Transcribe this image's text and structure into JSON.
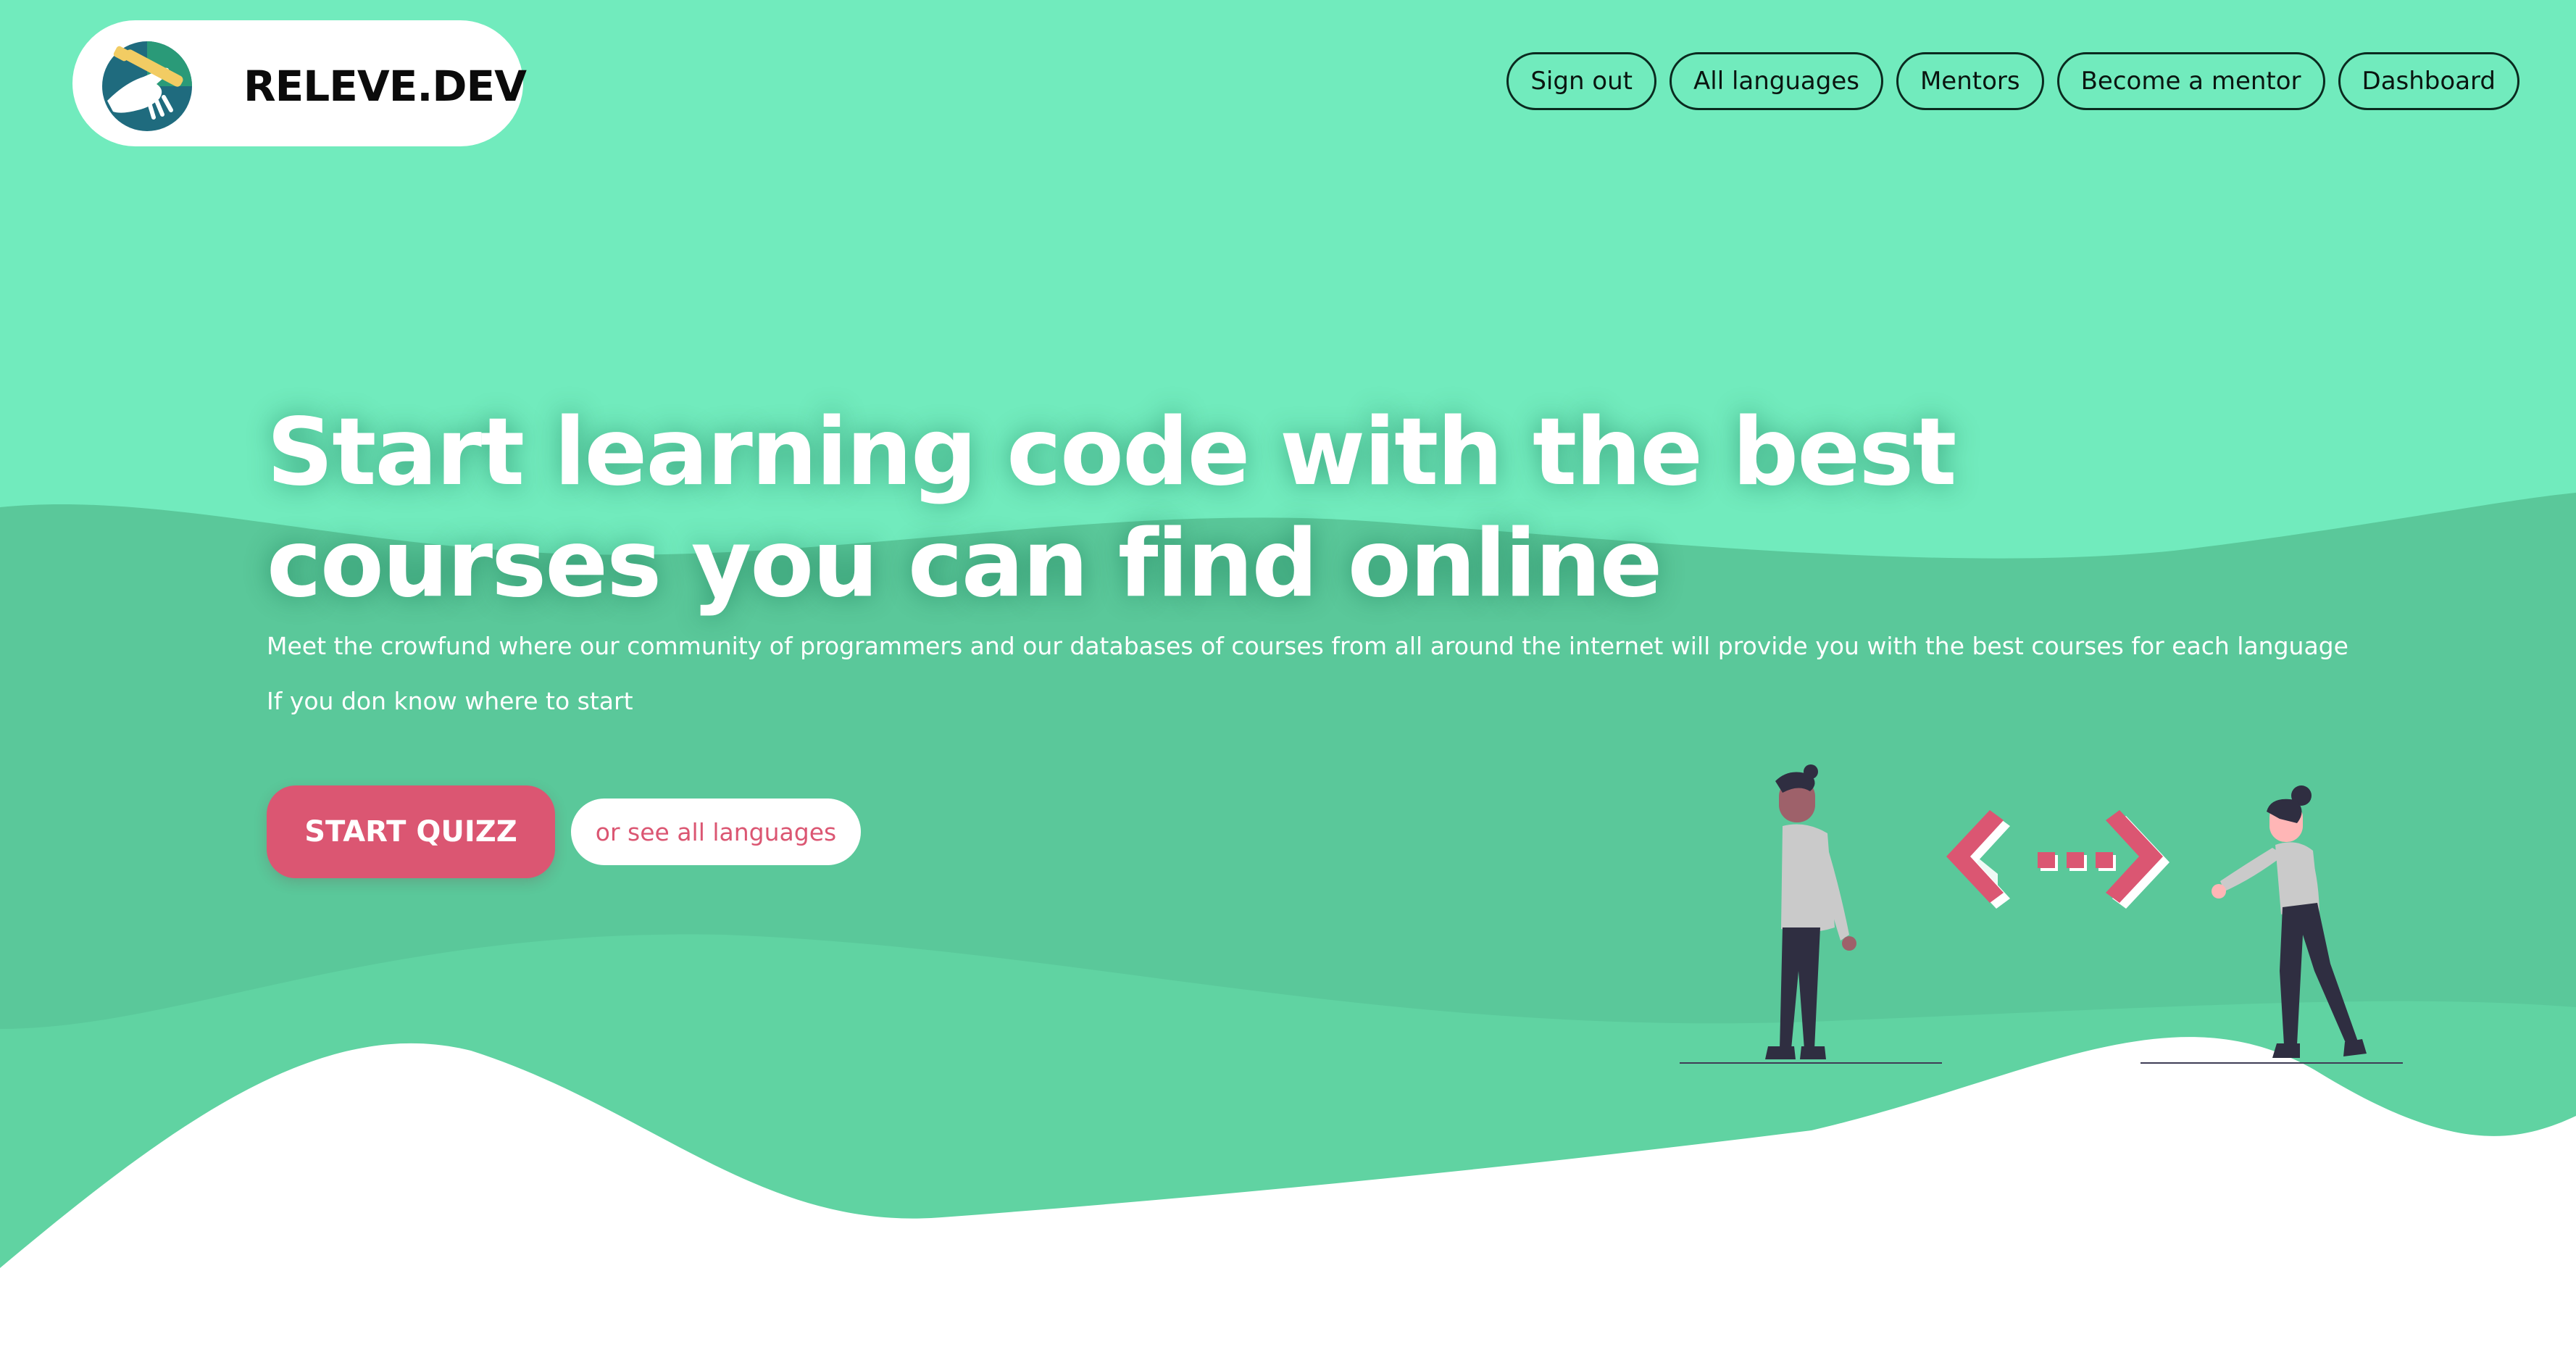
{
  "brand": {
    "name": "RELEVE.DEV",
    "logo_icon": "hand-with-pencil-logo-icon"
  },
  "nav": {
    "items": [
      {
        "label": "Sign out"
      },
      {
        "label": "All languages"
      },
      {
        "label": "Mentors"
      },
      {
        "label": "Become a mentor"
      },
      {
        "label": "Dashboard"
      }
    ]
  },
  "hero": {
    "title": "Start learning code with the best courses you can find online",
    "subtitle": "Meet the crowfund where our community of programmers and our databases of courses from all around the internet will provide you with the best courses for each language",
    "hint": "If you don know where to start"
  },
  "actions": {
    "quiz_label": "START QUIZZ",
    "all_languages_label": "or see all languages"
  },
  "illustration": {
    "icon": "two-people-code-brackets-illustration"
  },
  "colors": {
    "wave_light": "#71ebbd",
    "wave_mid": "#60d3a2",
    "wave_dark": "#5ac89a",
    "accent": "#db5672",
    "text_dark": "#0b0b0b"
  }
}
